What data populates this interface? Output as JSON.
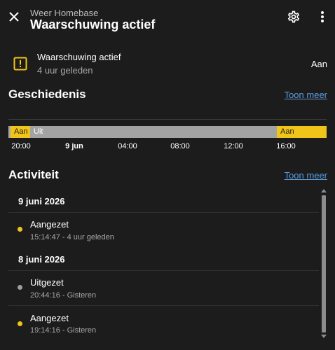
{
  "header": {
    "subtitle": "Weer Homebase",
    "title": "Waarschuwing actief"
  },
  "state": {
    "name": "Waarschuwing actief",
    "last_changed": "4 uur geleden",
    "value": "Aan",
    "accent_color": "#f0c419"
  },
  "history": {
    "title": "Geschiedenis",
    "more_link": "Toon meer",
    "segments": [
      {
        "label": "Aan",
        "state": "on"
      },
      {
        "label": "Uit",
        "state": "off"
      },
      {
        "label": "Aan",
        "state": "on"
      }
    ],
    "ticks": [
      "20:00",
      "9 jun",
      "04:00",
      "08:00",
      "12:00",
      "16:00"
    ]
  },
  "activity": {
    "title": "Activiteit",
    "more_link": "Toon meer",
    "groups": [
      {
        "date": "9 juni 2026",
        "entries": [
          {
            "name": "Aangezet",
            "meta": "15:14:47 - 4 uur geleden",
            "dot_color": "#f0c419"
          }
        ]
      },
      {
        "date": "8 juni 2026",
        "entries": [
          {
            "name": "Uitgezet",
            "meta": "20:44:16 - Gisteren",
            "dot_color": "#9e9e9e"
          },
          {
            "name": "Aangezet",
            "meta": "19:14:16 - Gisteren",
            "dot_color": "#f0c419"
          }
        ]
      }
    ]
  },
  "icons": {
    "close": "close-icon",
    "settings": "gear-icon",
    "more": "more-vertical-icon",
    "state": "alert-box-icon"
  }
}
